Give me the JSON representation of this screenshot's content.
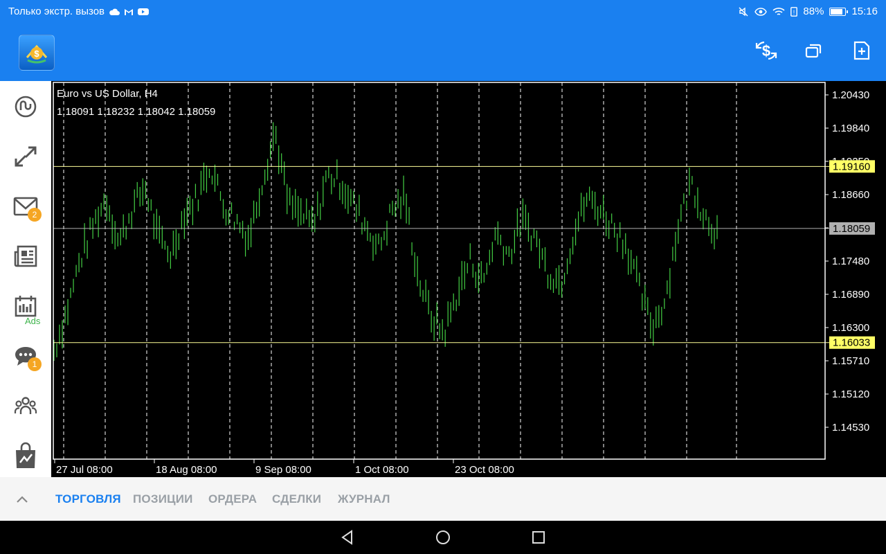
{
  "status": {
    "carrier": "Только экстр. вызов",
    "battery_percent": "88%",
    "time": "15:16",
    "battery_level": 0.88
  },
  "header": {
    "logo_icon": "metatrader-logo-icon",
    "buttons": [
      "currency-exchange-icon",
      "windows-icon",
      "new-document-icon"
    ]
  },
  "sidebar": {
    "items": [
      {
        "name": "quotes",
        "icon": "quotes-icon"
      },
      {
        "name": "trade",
        "icon": "trade-arrows-icon"
      },
      {
        "name": "mail",
        "icon": "mail-icon",
        "badge": "2"
      },
      {
        "name": "news",
        "icon": "news-icon"
      },
      {
        "name": "calendar",
        "icon": "calendar-icon",
        "label": "Ads"
      },
      {
        "name": "chat",
        "icon": "chat-icon",
        "badge": "1"
      },
      {
        "name": "community",
        "icon": "community-icon"
      },
      {
        "name": "market",
        "icon": "market-bag-icon"
      }
    ]
  },
  "chart": {
    "title": "Euro vs US Dollar, H4",
    "ohlc": "1.18091 1.18232 1.18042 1.18059",
    "price_levels": [
      "1.20430",
      "1.19840",
      "1.19250",
      "1.18660",
      "1.18070",
      "1.17480",
      "1.16890",
      "1.16300",
      "1.15710",
      "1.15120",
      "1.14530"
    ],
    "time_labels": [
      "27 Jul 08:00",
      "18 Aug 08:00",
      "9 Sep 08:00",
      "1 Oct 08:00",
      "23 Oct 08:00"
    ],
    "hlines": [
      {
        "price": 1.1916,
        "label": "1.19160",
        "color": "#ffff66"
      },
      {
        "price": 1.18059,
        "label": "1.18059",
        "color": "#b0b0b0"
      },
      {
        "price": 1.16033,
        "label": "1.16033",
        "color": "#ffff66"
      }
    ],
    "candle_color": "#44d044"
  },
  "chart_data": {
    "type": "line",
    "title": "Euro vs US Dollar, H4",
    "xlabel": "",
    "ylabel": "",
    "ylim": [
      1.14,
      1.207
    ],
    "categories": [
      "27 Jul 08:00",
      "18 Aug 08:00",
      "9 Sep 08:00",
      "1 Oct 08:00",
      "23 Oct 08:00"
    ],
    "series": [
      {
        "values": [
          1.159,
          1.166,
          1.175,
          1.181,
          1.186,
          1.178,
          1.184,
          1.188,
          1.179,
          1.176,
          1.183,
          1.186,
          1.192,
          1.185,
          1.182,
          1.179,
          1.189,
          1.198,
          1.185,
          1.183,
          1.181,
          1.19,
          1.189,
          1.185,
          1.181,
          1.177,
          1.184,
          1.186,
          1.172,
          1.165,
          1.162,
          1.169,
          1.175,
          1.171,
          1.18,
          1.176,
          1.182,
          1.179,
          1.173,
          1.171,
          1.18,
          1.186,
          1.184,
          1.181,
          1.178,
          1.17,
          1.163,
          1.168,
          1.181,
          1.189,
          1.183,
          1.18
        ]
      }
    ]
  },
  "tabs": [
    {
      "label": "ТОРГОВЛЯ",
      "active": true
    },
    {
      "label": "ПОЗИЦИИ",
      "active": false
    },
    {
      "label": "ОРДЕРА",
      "active": false
    },
    {
      "label": "СДЕЛКИ",
      "active": false
    },
    {
      "label": "ЖУРНАЛ",
      "active": false
    }
  ],
  "navbar": [
    "back-icon",
    "home-icon",
    "recents-icon"
  ]
}
